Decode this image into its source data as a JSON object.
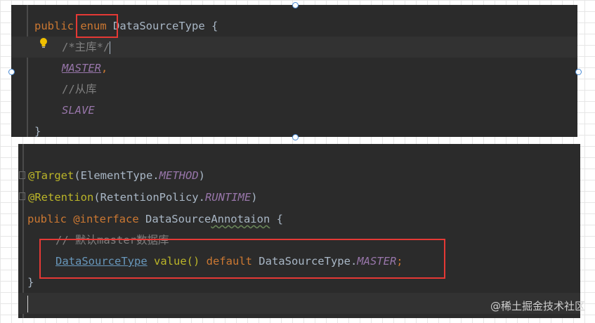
{
  "colors": {
    "editor_bg": "#2b2b2b",
    "keyword": "#cc7832",
    "constant": "#9876aa",
    "comment": "#808080",
    "annotation": "#bbb529",
    "plain": "#a9b7c6",
    "highlight_box": "#e53935"
  },
  "top_code": {
    "l1_kw": "public",
    "l1_enum": "enum",
    "l1_name": " DataSourceType {",
    "l2": "/*主库*/",
    "l3": "MASTER",
    "l3_comma": ",",
    "l4": "//从库",
    "l5": "SLAVE",
    "l6": "}"
  },
  "bottom_code": {
    "l1_ann": "@Target",
    "l1_rest": "(ElementType.",
    "l1_const": "METHOD",
    "l1_close": ")",
    "l2_ann": "@Retention",
    "l2_rest": "(RetentionPolicy.",
    "l2_const": "RUNTIME",
    "l2_close": ")",
    "l3_kw": "public",
    "l3_ann": " @interface ",
    "l3_name_a": "DataSource",
    "l3_name_b": "Annotaion",
    "l3_brace": " {",
    "l4": "// 默认master数据库",
    "l5_type": "DataSourceType",
    "l5_method": " value()",
    "l5_default": " default",
    "l5_ref": " DataSourceType.",
    "l5_const": "MASTER",
    "l5_semi": ";",
    "l6": "}"
  },
  "icons": {
    "bulb": "lightbulb-icon",
    "fold": "fold-marker-icon"
  },
  "watermark": "@稀土掘金技术社区"
}
